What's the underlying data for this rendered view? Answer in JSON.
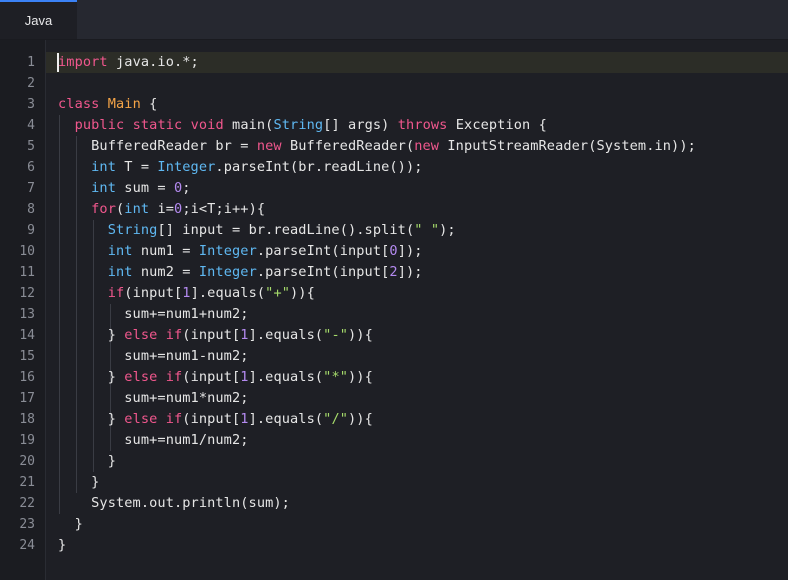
{
  "tab": {
    "label": "Java"
  },
  "lines": [
    [
      {
        "t": "import",
        "c": "kw"
      },
      {
        "t": " java.io.*;"
      }
    ],
    [],
    [
      {
        "t": "class",
        "c": "kw"
      },
      {
        "t": " "
      },
      {
        "t": "Main",
        "c": "cls"
      },
      {
        "t": " {"
      }
    ],
    [
      {
        "t": "  "
      },
      {
        "t": "public",
        "c": "kw"
      },
      {
        "t": " "
      },
      {
        "t": "static",
        "c": "kw"
      },
      {
        "t": " "
      },
      {
        "t": "void",
        "c": "kw"
      },
      {
        "t": " main("
      },
      {
        "t": "String",
        "c": "ty"
      },
      {
        "t": "[] args) "
      },
      {
        "t": "throws",
        "c": "kw"
      },
      {
        "t": " Exception {"
      }
    ],
    [
      {
        "t": "    BufferedReader br = "
      },
      {
        "t": "new",
        "c": "kw"
      },
      {
        "t": " BufferedReader("
      },
      {
        "t": "new",
        "c": "kw"
      },
      {
        "t": " InputStreamReader(System.in));"
      }
    ],
    [
      {
        "t": "    "
      },
      {
        "t": "int",
        "c": "ty"
      },
      {
        "t": " T = "
      },
      {
        "t": "Integer",
        "c": "ty"
      },
      {
        "t": ".parseInt(br.readLine());"
      }
    ],
    [
      {
        "t": "    "
      },
      {
        "t": "int",
        "c": "ty"
      },
      {
        "t": " sum = "
      },
      {
        "t": "0",
        "c": "nm"
      },
      {
        "t": ";"
      }
    ],
    [
      {
        "t": "    "
      },
      {
        "t": "for",
        "c": "kw"
      },
      {
        "t": "("
      },
      {
        "t": "int",
        "c": "ty"
      },
      {
        "t": " i="
      },
      {
        "t": "0",
        "c": "nm"
      },
      {
        "t": ";i<T;i++){"
      }
    ],
    [
      {
        "t": "      "
      },
      {
        "t": "String",
        "c": "ty"
      },
      {
        "t": "[] input = br.readLine().split("
      },
      {
        "t": "\" \"",
        "c": "st"
      },
      {
        "t": ");"
      }
    ],
    [
      {
        "t": "      "
      },
      {
        "t": "int",
        "c": "ty"
      },
      {
        "t": " num1 = "
      },
      {
        "t": "Integer",
        "c": "ty"
      },
      {
        "t": ".parseInt(input["
      },
      {
        "t": "0",
        "c": "nm"
      },
      {
        "t": "]);"
      }
    ],
    [
      {
        "t": "      "
      },
      {
        "t": "int",
        "c": "ty"
      },
      {
        "t": " num2 = "
      },
      {
        "t": "Integer",
        "c": "ty"
      },
      {
        "t": ".parseInt(input["
      },
      {
        "t": "2",
        "c": "nm"
      },
      {
        "t": "]);"
      }
    ],
    [
      {
        "t": "      "
      },
      {
        "t": "if",
        "c": "kw"
      },
      {
        "t": "(input["
      },
      {
        "t": "1",
        "c": "nm"
      },
      {
        "t": "].equals("
      },
      {
        "t": "\"+\"",
        "c": "st"
      },
      {
        "t": ")){"
      }
    ],
    [
      {
        "t": "        sum+=num1+num2;"
      }
    ],
    [
      {
        "t": "      } "
      },
      {
        "t": "else",
        "c": "kw"
      },
      {
        "t": " "
      },
      {
        "t": "if",
        "c": "kw"
      },
      {
        "t": "(input["
      },
      {
        "t": "1",
        "c": "nm"
      },
      {
        "t": "].equals("
      },
      {
        "t": "\"-\"",
        "c": "st"
      },
      {
        "t": ")){"
      }
    ],
    [
      {
        "t": "        sum+=num1-num2;"
      }
    ],
    [
      {
        "t": "      } "
      },
      {
        "t": "else",
        "c": "kw"
      },
      {
        "t": " "
      },
      {
        "t": "if",
        "c": "kw"
      },
      {
        "t": "(input["
      },
      {
        "t": "1",
        "c": "nm"
      },
      {
        "t": "].equals("
      },
      {
        "t": "\"*\"",
        "c": "st"
      },
      {
        "t": ")){"
      }
    ],
    [
      {
        "t": "        sum+=num1*num2;"
      }
    ],
    [
      {
        "t": "      } "
      },
      {
        "t": "else",
        "c": "kw"
      },
      {
        "t": " "
      },
      {
        "t": "if",
        "c": "kw"
      },
      {
        "t": "(input["
      },
      {
        "t": "1",
        "c": "nm"
      },
      {
        "t": "].equals("
      },
      {
        "t": "\"/\"",
        "c": "st"
      },
      {
        "t": ")){"
      }
    ],
    [
      {
        "t": "        sum+=num1/num2;"
      }
    ],
    [
      {
        "t": "      }"
      }
    ],
    [
      {
        "t": "    }"
      }
    ],
    [
      {
        "t": "    System.out.println(sum);"
      }
    ],
    [
      {
        "t": "  }"
      }
    ],
    [
      {
        "t": "}"
      }
    ]
  ]
}
